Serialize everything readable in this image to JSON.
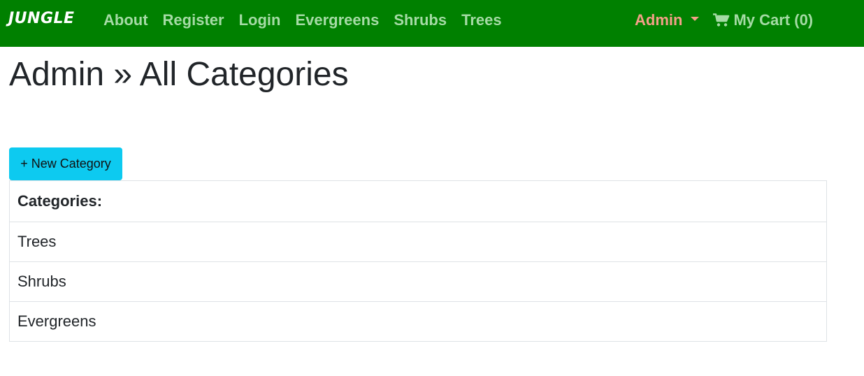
{
  "navbar": {
    "brand": "JUNGLE",
    "links": [
      "About",
      "Register",
      "Login",
      "Evergreens",
      "Shrubs",
      "Trees"
    ],
    "admin_label": "Admin",
    "cart_label": "My Cart (0)",
    "icons": {
      "caret": "chevron-down-icon",
      "cart": "shopping-cart-icon"
    }
  },
  "page": {
    "title": "Admin » All Categories",
    "new_button_label": "+ New Category"
  },
  "table": {
    "header": "Categories:",
    "rows": [
      "Trees",
      "Shrubs",
      "Evergreens"
    ]
  },
  "colors": {
    "navbar_bg": "#008000",
    "nav_link": "#a5dba5",
    "admin_link": "#f4a088",
    "button_bg": "#0dcaf0"
  }
}
